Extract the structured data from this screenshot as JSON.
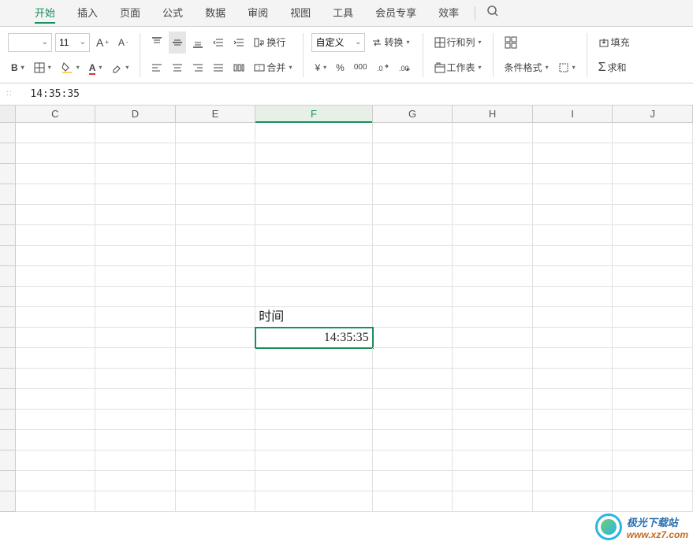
{
  "menu": {
    "items": [
      "开始",
      "插入",
      "页面",
      "公式",
      "数据",
      "审阅",
      "视图",
      "工具",
      "会员专享",
      "效率"
    ],
    "active_index": 0
  },
  "ribbon": {
    "font_size": "11",
    "increase_font": "A⁺",
    "decrease_font": "A⁻",
    "number_format": "自定义",
    "wrap_text": "换行",
    "merge": "合并",
    "convert": "转换",
    "rows_cols": "行和列",
    "worksheet": "工作表",
    "cond_format": "条件格式",
    "sum": "求和",
    "fill": "填充",
    "currency_symbol": "¥",
    "percent": "%",
    "thousands": "000",
    "inc_decimal": ".0→.00",
    "dec_decimal": ".00→.0"
  },
  "formula_bar": {
    "value": "14:35:35"
  },
  "columns": [
    "C",
    "D",
    "E",
    "F",
    "G",
    "H",
    "I",
    "J"
  ],
  "selected_column": "F",
  "cells": {
    "F11_label": "时间",
    "F12_value": "14:35:35"
  },
  "watermark": {
    "title": "极光下载站",
    "url": "www.xz7.com"
  }
}
